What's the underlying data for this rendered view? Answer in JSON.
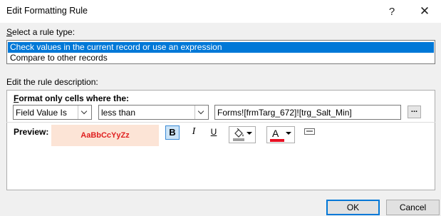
{
  "window": {
    "title": "Edit Formatting Rule",
    "help_glyph": "?",
    "close_glyph": "✕"
  },
  "rule_type": {
    "label": "Select a rule type:",
    "label_mnemonic": "S",
    "label_rest": "elect a rule type:",
    "items": [
      {
        "label": "Check values in the current record or use an expression",
        "selected": true
      },
      {
        "label": "Compare to other records",
        "selected": false
      }
    ]
  },
  "description": {
    "label": "Edit the rule description:",
    "condition_label_mnemonic": "F",
    "condition_label_rest": "ormat only cells where the:",
    "field_select": "Field Value Is",
    "operator_select": "less than",
    "expression": "Forms![frmTarg_672]![trg_Salt_Min]",
    "builder_glyph": "...",
    "preview_label": "Preview:",
    "preview_text": "AaBbCcYyZz",
    "preview_bg": "#fce4d6",
    "preview_color": "#e02020",
    "bold_glyph": "B",
    "italic_glyph": "I",
    "underline_glyph": "U",
    "font_color_glyph": "A",
    "fill_color": "#9e9e9e",
    "font_color": "#e81123"
  },
  "buttons": {
    "ok": "OK",
    "cancel": "Cancel"
  }
}
